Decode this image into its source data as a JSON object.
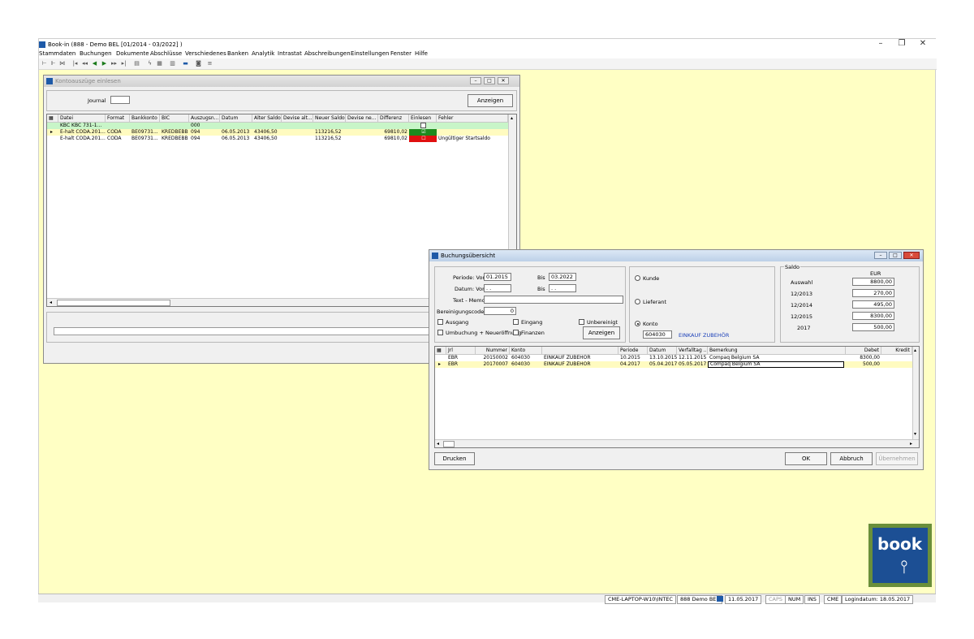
{
  "window": {
    "title": "Book-in (888 - Demo BEL [01/2014 - 03/2022] )",
    "minimize": "–",
    "restore": "❐",
    "close": "✕"
  },
  "menu": [
    "Stammdaten",
    "Buchungen",
    "Dokumente",
    "Abschlüsse",
    "Verschiedenes",
    "Banken",
    "Analytik",
    "Intrastat",
    "Abschreibungen",
    "Einstellungen",
    "Fenster",
    "Hilfe"
  ],
  "kontoauszuege": {
    "title": "Kontoauszüge einlesen",
    "journal_label": "Journal",
    "journal_value": "",
    "anzeigen": "Anzeigen",
    "columns": [
      "Datei",
      "Format",
      "Bankkonto",
      "BIC",
      "Auszugsn...",
      "Datum",
      "Alter Saldo",
      "Devise alt...",
      "Neuer Saldo",
      "Devise ne...",
      "Differenz",
      "Einlesen",
      "Fehler"
    ],
    "rows": [
      {
        "datei": "KBC   KBC 731-1...",
        "format": "",
        "bankkonto": "",
        "bic": "",
        "auszug": "000",
        "datum": "",
        "alter": "",
        "devalt": "",
        "neuer": "",
        "devneu": "",
        "diff": "",
        "einlesen": "",
        "fehler": ""
      },
      {
        "datei": "E-halt CODA.201...",
        "format": "CODA",
        "bankkonto": "BE09731...",
        "bic": "KREDBEBB",
        "auszug": "094",
        "datum": "06.05.2013",
        "alter": "43406,50",
        "devalt": "",
        "neuer": "113216,52",
        "devneu": "",
        "diff": "69810,02",
        "einlesen": "☑",
        "fehler": ""
      },
      {
        "datei": "E-halt CODA.201...",
        "format": "CODA",
        "bankkonto": "BE09731...",
        "bic": "KREDBEBB",
        "auszug": "094",
        "datum": "06.05.2013",
        "alter": "43406,50",
        "devalt": "",
        "neuer": "113216,52",
        "devneu": "",
        "diff": "69810,02",
        "einlesen": "☐",
        "fehler": "Ungültiger Startsaldo"
      }
    ]
  },
  "buchung": {
    "title": "Buchungsübersicht",
    "periode_von_label": "Periode: Von",
    "periode_von": "01.2015",
    "periode_bis_label": "Bis",
    "periode_bis": "03.2022",
    "datum_von_label": "Datum: Von",
    "datum_von": ". .",
    "datum_bis_label": "Bis",
    "datum_bis": ". .",
    "text_memo_label": "Text - Memo",
    "text_memo": "",
    "bereinigung_label": "Bereinigungscode",
    "bereinigung": "0",
    "ausgang": "Ausgang",
    "eingang": "Eingang",
    "unbereinigt": "Unbereinigt",
    "umbuchung": "Umbuchung + Neueröffnung",
    "finanzen": "Finanzen",
    "anzeigen": "Anzeigen",
    "kunde": "Kunde",
    "lieferant": "Lieferant",
    "konto": "Konto",
    "konto_nr": "604030",
    "konto_name": "EINKAUF ZUBEHÖR",
    "saldo_title": "Saldo",
    "currency": "EUR",
    "saldo": [
      {
        "label": "Auswahl",
        "value": "8800,00"
      },
      {
        "label": "12/2013",
        "value": "270,00"
      },
      {
        "label": "12/2014",
        "value": "495,00"
      },
      {
        "label": "12/2015",
        "value": "8300,00"
      },
      {
        "label": "2017",
        "value": "500,00"
      }
    ],
    "columns": [
      "Jrl",
      "Nummer",
      "Konto",
      "",
      "Periode",
      "Datum",
      "Verfalltag ...",
      "Bemerkung",
      "Debet",
      "Kredit"
    ],
    "rows": [
      {
        "jrl": "EBR",
        "nummer": "20150002",
        "konto": "604030",
        "name": "EINKAUF ZUBEHÖR",
        "periode": "10.2015",
        "datum": "13.10.2015",
        "verfall": "12.11.2015",
        "bemerkung": "Compaq Belgium SA",
        "debet": "8300,00",
        "kredit": ""
      },
      {
        "jrl": "EBR",
        "nummer": "20170007",
        "konto": "604030",
        "name": "EINKAUF ZUBEHÖR",
        "periode": "04.2017",
        "datum": "05.04.2017",
        "verfall": "05.05.2017",
        "bemerkung": "Compaq Belgium SA",
        "debet": "500,00",
        "kredit": ""
      }
    ],
    "drucken": "Drucken",
    "ok": "OK",
    "abbruch": "Abbruch",
    "uebernehmen": "Übernehmen"
  },
  "logo": {
    "text": "book"
  },
  "status": [
    "CME-LAPTOP-W10\\INTEC",
    "888 Demo BEL",
    "11.05.2017",
    "CAPS",
    "NUM",
    "INS",
    "CME",
    "Logindatum: 18.05.2017"
  ],
  "colors": {
    "green": "#1e8a1e",
    "red": "#e01010",
    "selected_row": "#fffbc0",
    "group_row": "#c8f5c8"
  }
}
